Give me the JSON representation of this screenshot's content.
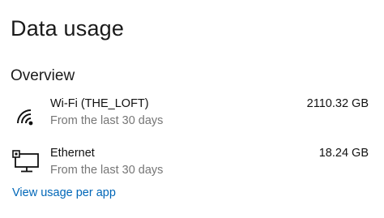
{
  "page": {
    "title": "Data usage"
  },
  "overview": {
    "heading": "Overview",
    "items": [
      {
        "icon": "wifi-icon",
        "name": "Wi-Fi (THE_LOFT)",
        "period": "From the last 30 days",
        "usage": "2110.32 GB"
      },
      {
        "icon": "ethernet-icon",
        "name": "Ethernet",
        "period": "From the last 30 days",
        "usage": "18.24 GB"
      }
    ]
  },
  "links": {
    "view_usage_per_app": "View usage per app"
  },
  "colors": {
    "link": "#0067b8",
    "secondary_text": "#767676"
  }
}
